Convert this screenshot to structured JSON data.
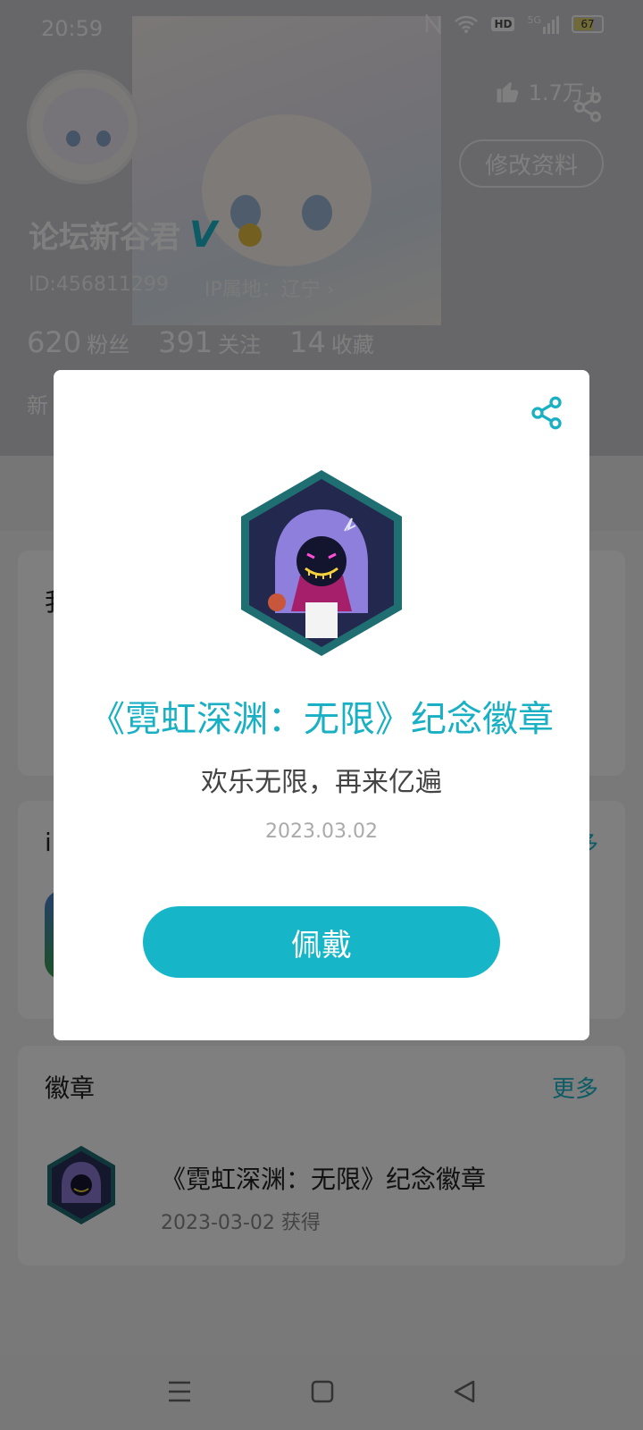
{
  "status_bar": {
    "time": "20:59",
    "battery": "67",
    "network": "5G",
    "hd": "HD"
  },
  "profile": {
    "likes": "1.7万+",
    "edit_label": "修改资料",
    "name": "论坛新谷君",
    "vip": "V",
    "id_text": "ID:456811299",
    "ip_text": "IP属地：辽宁 ›",
    "stats": [
      {
        "num": "620",
        "label": "粉丝"
      },
      {
        "num": "391",
        "label": "关注"
      },
      {
        "num": "14",
        "label": "收藏"
      }
    ],
    "bio": "新"
  },
  "cards": {
    "card1_title": "我",
    "card2_title": "i",
    "card2_more": "多",
    "badges": {
      "title": "徽章",
      "more": "更多",
      "item": {
        "name": "《霓虹深渊：无限》纪念徽章",
        "date": "2023-03-02 获得"
      }
    }
  },
  "modal": {
    "title": "《霓虹深渊：无限》纪念徽章",
    "description": "欢乐无限，再来亿遍",
    "date": "2023.03.02",
    "button": "佩戴"
  },
  "colors": {
    "accent": "#16b6c8",
    "title": "#19b0c4",
    "badge_border": "#1f7a7a"
  },
  "icons": [
    "share-icon",
    "thumb-up-icon",
    "menu-icon",
    "home-icon",
    "back-icon"
  ]
}
